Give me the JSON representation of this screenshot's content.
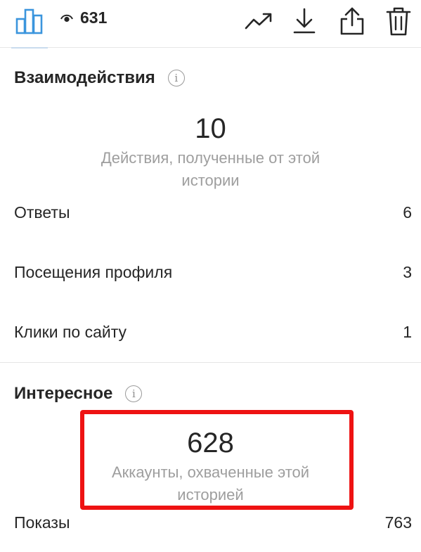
{
  "header": {
    "views_count": "631",
    "icons": {
      "stats_tab": "bar-chart-icon",
      "views": "eye-icon",
      "promote": "trending-up-icon",
      "download": "download-icon",
      "share": "share-icon",
      "delete": "trash-icon"
    },
    "accent_color": "#3897f0"
  },
  "interactions": {
    "title": "Взаимодействия",
    "total": "10",
    "caption": "Действия, полученные от этой истории",
    "rows": [
      {
        "label": "Ответы",
        "value": "6"
      },
      {
        "label": "Посещения профиля",
        "value": "3"
      },
      {
        "label": "Клики по сайту",
        "value": "1"
      }
    ]
  },
  "discovery": {
    "title": "Интересное",
    "total": "628",
    "caption": "Аккаунты, охваченные этой историей",
    "rows": [
      {
        "label": "Показы",
        "value": "763"
      }
    ]
  },
  "annotation": {
    "highlight_color": "#ee1212"
  }
}
